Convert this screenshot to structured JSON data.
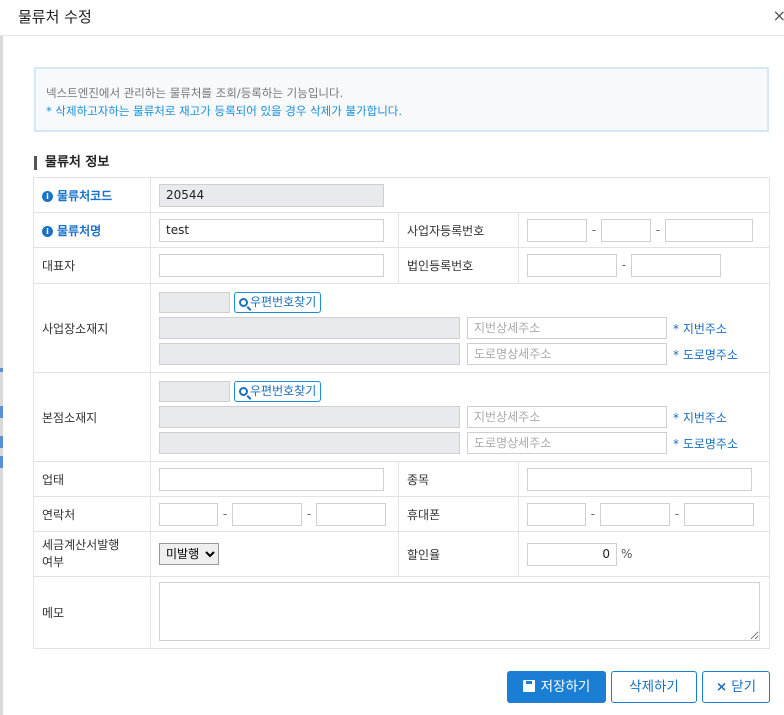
{
  "modal": {
    "title": "물류처 수정",
    "close": "×"
  },
  "info": {
    "line1": "넥스트엔진에서 관리하는 물류처를 조회/등록하는 기능입니다.",
    "line2": "* 삭제하고자하는 물류처로 재고가 등록되어 있을 경우 삭제가 불가합니다."
  },
  "section": {
    "title": "물류처 정보"
  },
  "form": {
    "code_label": "물류처코드",
    "code_value": "20544",
    "name_label": "물류처명",
    "name_value": "test",
    "bizno_label": "사업자등록번호",
    "ceo_label": "대표자",
    "corpno_label": "법인등록번호",
    "biz_addr_label": "사업장소재지",
    "hq_addr_label": "본점소재지",
    "zip_button": "우편번호찾기",
    "jibun_placeholder": "지번상세주소",
    "road_placeholder": "도로명상세주소",
    "jibun_note": "* 지번주소",
    "road_note": "* 도로명주소",
    "biztype_label": "업태",
    "bizitem_label": "종목",
    "phone_label": "연락처",
    "mobile_label": "휴대폰",
    "invoice_label_1": "세금계산서발행",
    "invoice_label_2": "여부",
    "invoice_selected": "미발행",
    "discount_label": "할인율",
    "discount_value": "0",
    "discount_unit": "%",
    "memo_label": "메모",
    "dash": "-"
  },
  "buttons": {
    "save": "저장하기",
    "delete": "삭제하기",
    "close": "닫기",
    "close_icon": "×"
  },
  "icons": {
    "info": "i",
    "search": "search-icon",
    "save": "floppy-disk-icon"
  },
  "colors": {
    "accent": "#1a7fd4",
    "label_required": "#1a73c8",
    "info_text": "#1a8fd8"
  }
}
